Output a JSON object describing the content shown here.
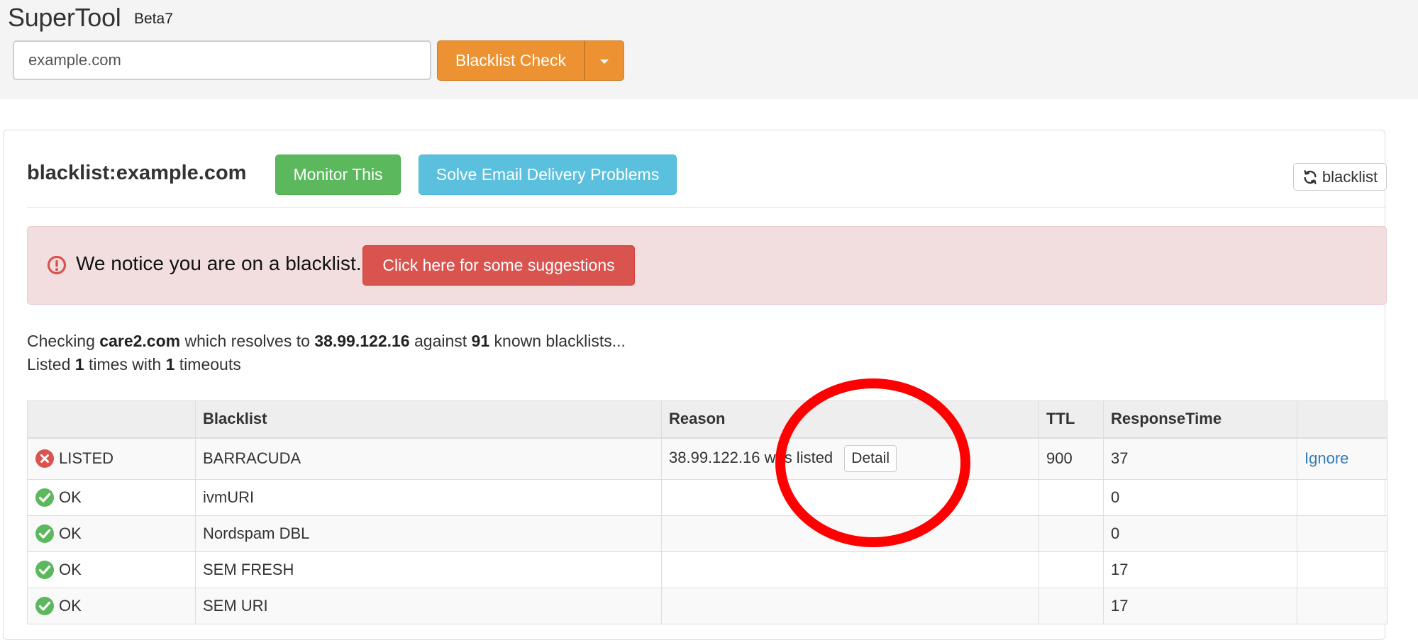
{
  "header": {
    "brand": "SuperTool",
    "beta": "Beta7",
    "search_value": "example.com",
    "check_button": "Blacklist Check"
  },
  "panel": {
    "title": "blacklist:example.com",
    "monitor_button": "Monitor This",
    "solve_button": "Solve Email Delivery Problems",
    "refresh_button": "blacklist"
  },
  "alert": {
    "message": "We notice you are on a blacklist.",
    "button": "Click here for some suggestions"
  },
  "summary": {
    "checking_label": "Checking",
    "domain": "care2.com",
    "resolves_label": "which resolves to",
    "ip": "38.99.122.16",
    "against_label": "against",
    "count": "91",
    "known_label": "known blacklists...",
    "listed_label": "Listed",
    "listed_count": "1",
    "times_label": "times with",
    "timeout_count": "1",
    "timeouts_label": "timeouts"
  },
  "table": {
    "headers": [
      "",
      "Blacklist",
      "Reason",
      "TTL",
      "ResponseTime",
      ""
    ],
    "rows": [
      {
        "status": "LISTED",
        "blacklist": "BARRACUDA",
        "reason": "38.99.122.16 was listed",
        "detail": "Detail",
        "ttl": "900",
        "response_time": "37",
        "action": "Ignore"
      },
      {
        "status": "OK",
        "blacklist": "ivmURI",
        "reason": "",
        "ttl": "",
        "response_time": "0",
        "action": ""
      },
      {
        "status": "OK",
        "blacklist": "Nordspam DBL",
        "reason": "",
        "ttl": "",
        "response_time": "0",
        "action": ""
      },
      {
        "status": "OK",
        "blacklist": "SEM FRESH",
        "reason": "",
        "ttl": "",
        "response_time": "17",
        "action": ""
      },
      {
        "status": "OK",
        "blacklist": "SEM URI",
        "reason": "",
        "ttl": "",
        "response_time": "17",
        "action": ""
      }
    ]
  },
  "colors": {
    "accent_orange": "#ec9233",
    "monitor_green": "#5cb85c",
    "solve_blue": "#5bc0de",
    "danger_red": "#d9534f",
    "alert_bg": "#f2dede",
    "ok_green": "#5cb85c",
    "annotation_red": "#ff0000",
    "link_blue": "#337ab7"
  },
  "icons": {
    "alert": "exclamation-circle-icon",
    "listed": "x-circle-icon",
    "ok": "check-circle-icon",
    "refresh": "refresh-icon",
    "dropdown": "caret-down-icon"
  }
}
